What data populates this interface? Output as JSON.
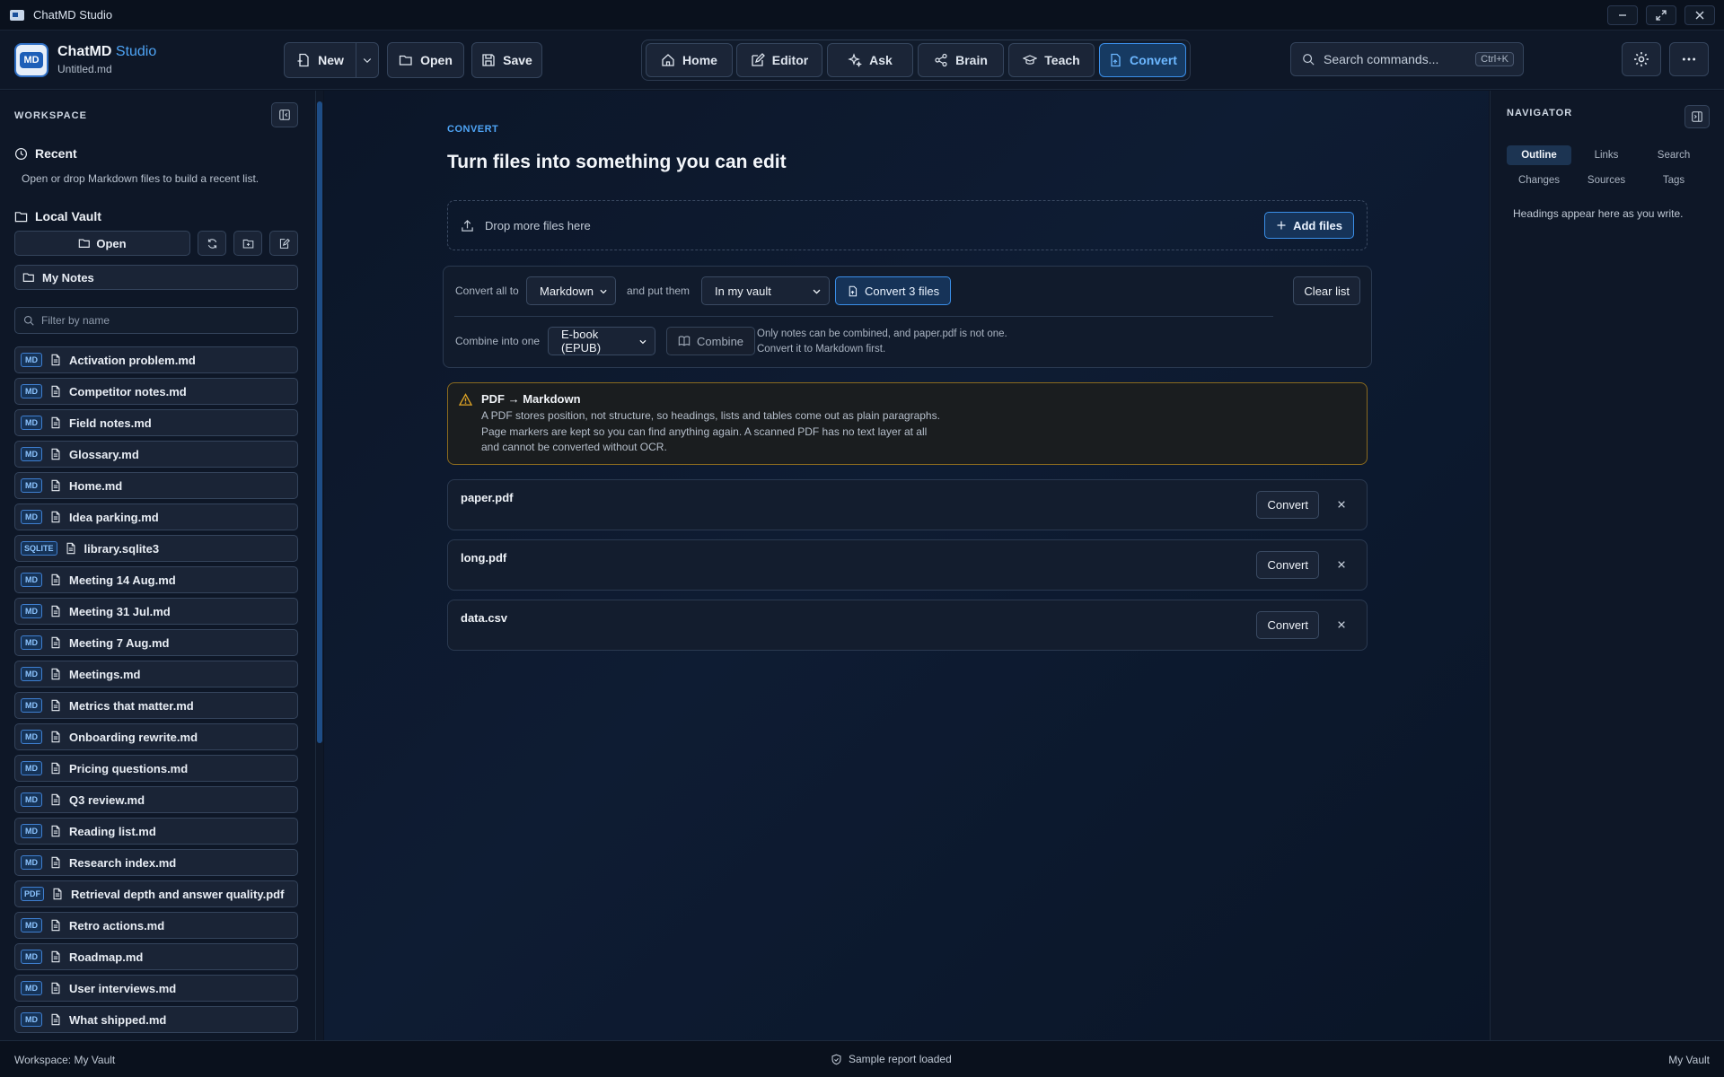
{
  "window": {
    "title": "ChatMD Studio"
  },
  "header": {
    "logo_text": "MD",
    "brand_name": "ChatMD",
    "brand_suffix": "Studio",
    "filename": "Untitled.md",
    "new_label": "New",
    "open_label": "Open",
    "save_label": "Save",
    "nav": [
      "Home",
      "Editor",
      "Ask",
      "Brain",
      "Teach",
      "Convert"
    ],
    "active_nav": "Convert",
    "search_placeholder": "Search commands...",
    "search_shortcut": "Ctrl+K"
  },
  "sidebar": {
    "heading": "WORKSPACE",
    "recent_title": "Recent",
    "recent_hint": "Open or drop Markdown files to build a recent list.",
    "vault_title": "Local Vault",
    "open_label": "Open",
    "folder_label": "My Notes",
    "filter_placeholder": "Filter by name",
    "files": [
      {
        "badge": "MD",
        "name": "Activation problem.md"
      },
      {
        "badge": "MD",
        "name": "Competitor notes.md"
      },
      {
        "badge": "MD",
        "name": "Field notes.md"
      },
      {
        "badge": "MD",
        "name": "Glossary.md"
      },
      {
        "badge": "MD",
        "name": "Home.md"
      },
      {
        "badge": "MD",
        "name": "Idea parking.md"
      },
      {
        "badge": "SQLITE",
        "name": "library.sqlite3"
      },
      {
        "badge": "MD",
        "name": "Meeting 14 Aug.md"
      },
      {
        "badge": "MD",
        "name": "Meeting 31 Jul.md"
      },
      {
        "badge": "MD",
        "name": "Meeting 7 Aug.md"
      },
      {
        "badge": "MD",
        "name": "Meetings.md"
      },
      {
        "badge": "MD",
        "name": "Metrics that matter.md"
      },
      {
        "badge": "MD",
        "name": "Onboarding rewrite.md"
      },
      {
        "badge": "MD",
        "name": "Pricing questions.md"
      },
      {
        "badge": "MD",
        "name": "Q3 review.md"
      },
      {
        "badge": "MD",
        "name": "Reading list.md"
      },
      {
        "badge": "MD",
        "name": "Research index.md"
      },
      {
        "badge": "PDF",
        "name": "Retrieval depth and answer quality.pdf"
      },
      {
        "badge": "MD",
        "name": "Retro actions.md"
      },
      {
        "badge": "MD",
        "name": "Roadmap.md"
      },
      {
        "badge": "MD",
        "name": "User interviews.md"
      },
      {
        "badge": "MD",
        "name": "What shipped.md"
      }
    ]
  },
  "convert": {
    "eyebrow": "CONVERT",
    "title": "Turn files into something you can edit",
    "drop_text": "Drop more files here",
    "add_files_label": "Add files",
    "convert_all_label": "Convert all to",
    "format_value": "Markdown",
    "put_label": "and put them",
    "destination_value": "In my vault",
    "convert_button": "Convert 3 files",
    "clear_button": "Clear list",
    "combine_label": "Combine into one",
    "combine_format": "E-book (EPUB)",
    "combine_button": "Combine",
    "combine_note_1": "Only notes can be combined, and paper.pdf is not one.",
    "combine_note_2": "Convert it to Markdown first.",
    "warning_title": "PDF → Markdown",
    "warning_line_1": "A PDF stores position, not structure, so headings, lists and tables come out as plain paragraphs.",
    "warning_line_2": "Page markers are kept so you can find anything again. A scanned PDF has no text layer at all",
    "warning_line_3": "and cannot be converted without OCR.",
    "queue": [
      {
        "name": "paper.pdf",
        "action": "Convert"
      },
      {
        "name": "long.pdf",
        "action": "Convert"
      },
      {
        "name": "data.csv",
        "action": "Convert"
      }
    ]
  },
  "navigator": {
    "heading": "NAVIGATOR",
    "tabs": [
      "Outline",
      "Links",
      "Search",
      "Changes",
      "Sources",
      "Tags"
    ],
    "active_tab": "Outline",
    "empty_text": "Headings appear here as you write."
  },
  "statusbar": {
    "left": "Workspace: My Vault",
    "center": "Sample report loaded",
    "right": "My Vault"
  },
  "colors": {
    "accent": "#4ea4f5",
    "warning": "#e0a526",
    "background": "#0b1322"
  }
}
